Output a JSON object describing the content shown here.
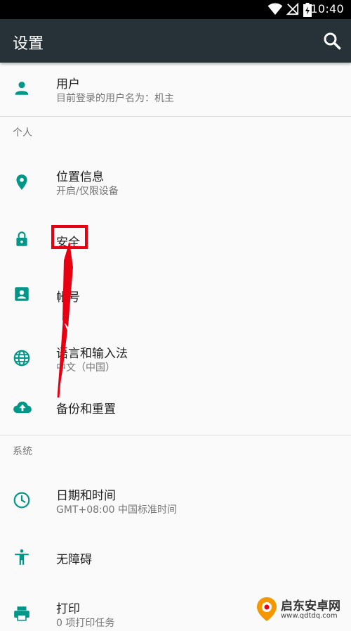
{
  "status_bar": {
    "time": "10:40",
    "icons": [
      "wifi-icon",
      "no-signal-icon",
      "battery-charging-icon"
    ]
  },
  "app_bar": {
    "title": "设置",
    "search_icon": "search-icon"
  },
  "user": {
    "title": "用户",
    "subtitle": "目前登录的用户名为：机主",
    "icon": "person-icon"
  },
  "sections": {
    "personal": "个人",
    "system": "系统"
  },
  "personal_items": [
    {
      "title": "位置信息",
      "subtitle": "开启/仅限设备",
      "icon": "location-pin-icon"
    },
    {
      "title": "安全",
      "subtitle": "",
      "icon": "lock-icon"
    },
    {
      "title": "帐号",
      "subtitle": "",
      "icon": "account-box-icon"
    },
    {
      "title": "语言和输入法",
      "subtitle": "中文（中国）",
      "icon": "globe-icon"
    },
    {
      "title": "备份和重置",
      "subtitle": "",
      "icon": "cloud-upload-icon"
    }
  ],
  "system_items": [
    {
      "title": "日期和时间",
      "subtitle": "GMT+08:00 中国标准时间",
      "icon": "clock-icon"
    },
    {
      "title": "无障碍",
      "subtitle": "",
      "icon": "accessibility-icon"
    },
    {
      "title": "打印",
      "subtitle": "0 项打印任务",
      "icon": "printer-icon"
    }
  ],
  "annotation": {
    "highlight_color": "#e60012",
    "target": "安全"
  },
  "watermark": {
    "name": "启东安卓网",
    "url": "www.qdtdq.com"
  },
  "colors": {
    "app_bar": "#263238",
    "icon_teal": "#009688",
    "background": "#fafafa"
  }
}
